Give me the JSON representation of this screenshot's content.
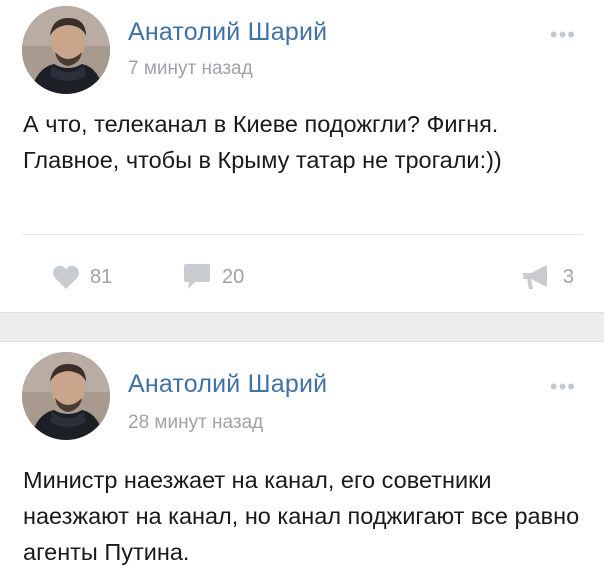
{
  "posts": [
    {
      "author": "Анатолий Шарий",
      "time": "7 минут назад",
      "text": "А что, телеканал в Киеве подожгли? Фигня. Главное, чтобы в Крыму татар не трогали:))",
      "likes": "81",
      "comments": "20",
      "reposts": "3",
      "more_label": "•••"
    },
    {
      "author": "Анатолий Шарий",
      "time": "28 минут назад",
      "text": "Министр наезжает на канал, его советники наезжают на канал, но канал поджигают все равно агенты Путина.",
      "more_label": "•••"
    }
  ],
  "colors": {
    "author": "#3f72a9",
    "meta": "#9fa3a8",
    "separator": "#ededee"
  },
  "icons": {
    "like": "heart-icon",
    "comment": "comment-bubble-icon",
    "repost": "megaphone-icon",
    "more": "more-dots-icon"
  }
}
